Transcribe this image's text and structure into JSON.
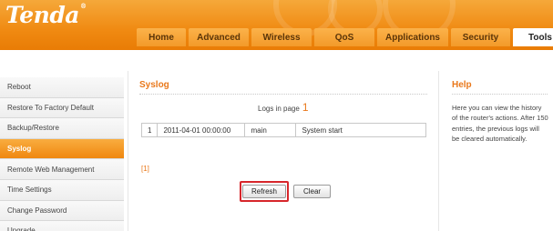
{
  "header": {
    "logo_text": "Tenda",
    "logo_mark": "®",
    "brand_color": "#f08a12"
  },
  "nav": {
    "tabs": [
      {
        "label": "Home"
      },
      {
        "label": "Advanced"
      },
      {
        "label": "Wireless"
      },
      {
        "label": "QoS"
      },
      {
        "label": "Applications"
      },
      {
        "label": "Security"
      },
      {
        "label": "Tools",
        "active": true
      }
    ]
  },
  "sidebar": {
    "items": [
      {
        "label": "Reboot"
      },
      {
        "label": "Restore To Factory Default"
      },
      {
        "label": "Backup/Restore"
      },
      {
        "label": "Syslog",
        "active": true
      },
      {
        "label": "Remote Web Management"
      },
      {
        "label": "Time Settings"
      },
      {
        "label": "Change Password"
      },
      {
        "label": "Upgrade"
      }
    ]
  },
  "main": {
    "title": "Syslog",
    "logs_label": "Logs in page",
    "logs_page": "1",
    "log_rows": [
      {
        "index": "1",
        "time": "2011-04-01 00:00:00",
        "type": "main",
        "message": "System start"
      }
    ],
    "page_link": "[1]",
    "refresh_label": "Refresh",
    "clear_label": "Clear",
    "highlight_color": "#d7262b"
  },
  "help": {
    "title": "Help",
    "text": "Here you can view the history of the router's actions. After 150 entries, the previous logs will be cleared automatically."
  }
}
